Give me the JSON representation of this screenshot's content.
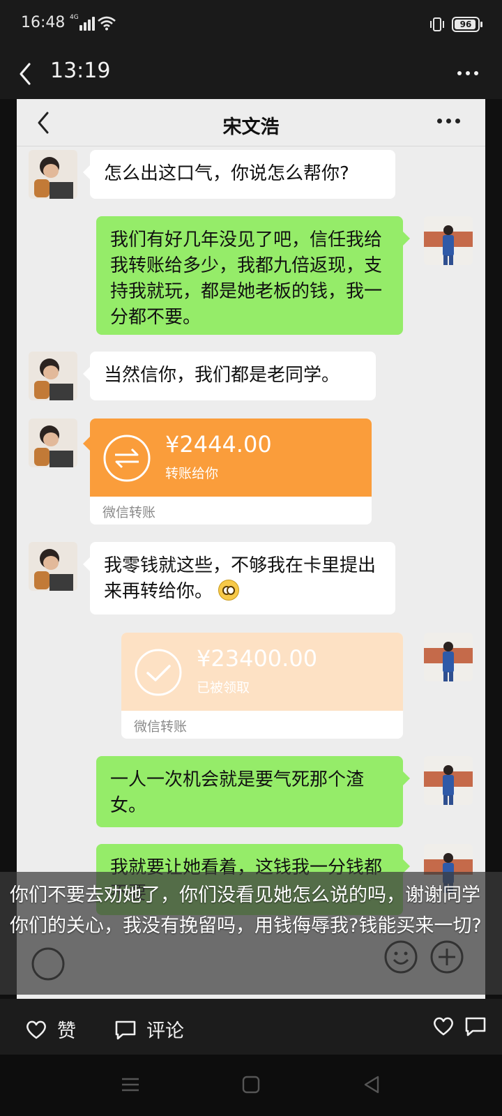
{
  "status_bar": {
    "time": "16:48",
    "network": "4G",
    "battery": "96"
  },
  "viewer": {
    "title": "13:19"
  },
  "chat": {
    "contact_name": "宋文浩",
    "messages": [
      {
        "side": "left",
        "text": "怎么出这口气，你说怎么帮你?"
      },
      {
        "side": "right",
        "text": "我们有好几年没见了吧，信任我给我转账给多少，我都九倍返现，支持我就玩，都是她老板的钱，我一分都不要。"
      },
      {
        "side": "left",
        "text": "当然信你，我们都是老同学。"
      },
      {
        "side": "right",
        "text": "一人一次机会就是要气死那个渣女。"
      },
      {
        "side": "right",
        "text": "我就要让她看着，这钱我一分钱都不要"
      }
    ],
    "msg5_before_emoji": "我零钱就这些，不够我在卡里提出来再转给你。",
    "transfer_1": {
      "amount": "¥2444.00",
      "note": "转账给你",
      "footer": "微信转账"
    },
    "transfer_2": {
      "amount": "¥23400.00",
      "note": "已被领取",
      "footer": "微信转账"
    }
  },
  "caption": "你们不要去劝她了，你们没看见她怎么说的吗，谢谢同学你们的关心，我没有挽留吗，用钱侮辱我?钱能买来一切?",
  "actions": {
    "like_label": "赞",
    "comment_label": "评论"
  },
  "icons": [
    "back-icon",
    "more-icon",
    "wifi-icon",
    "signal-icon",
    "vibrate-icon",
    "battery-icon",
    "transfer-icon",
    "check-icon",
    "emoji-icon",
    "plus-icon",
    "heart-icon",
    "comment-icon",
    "menu-icon",
    "home-icon",
    "nav-back-icon"
  ]
}
